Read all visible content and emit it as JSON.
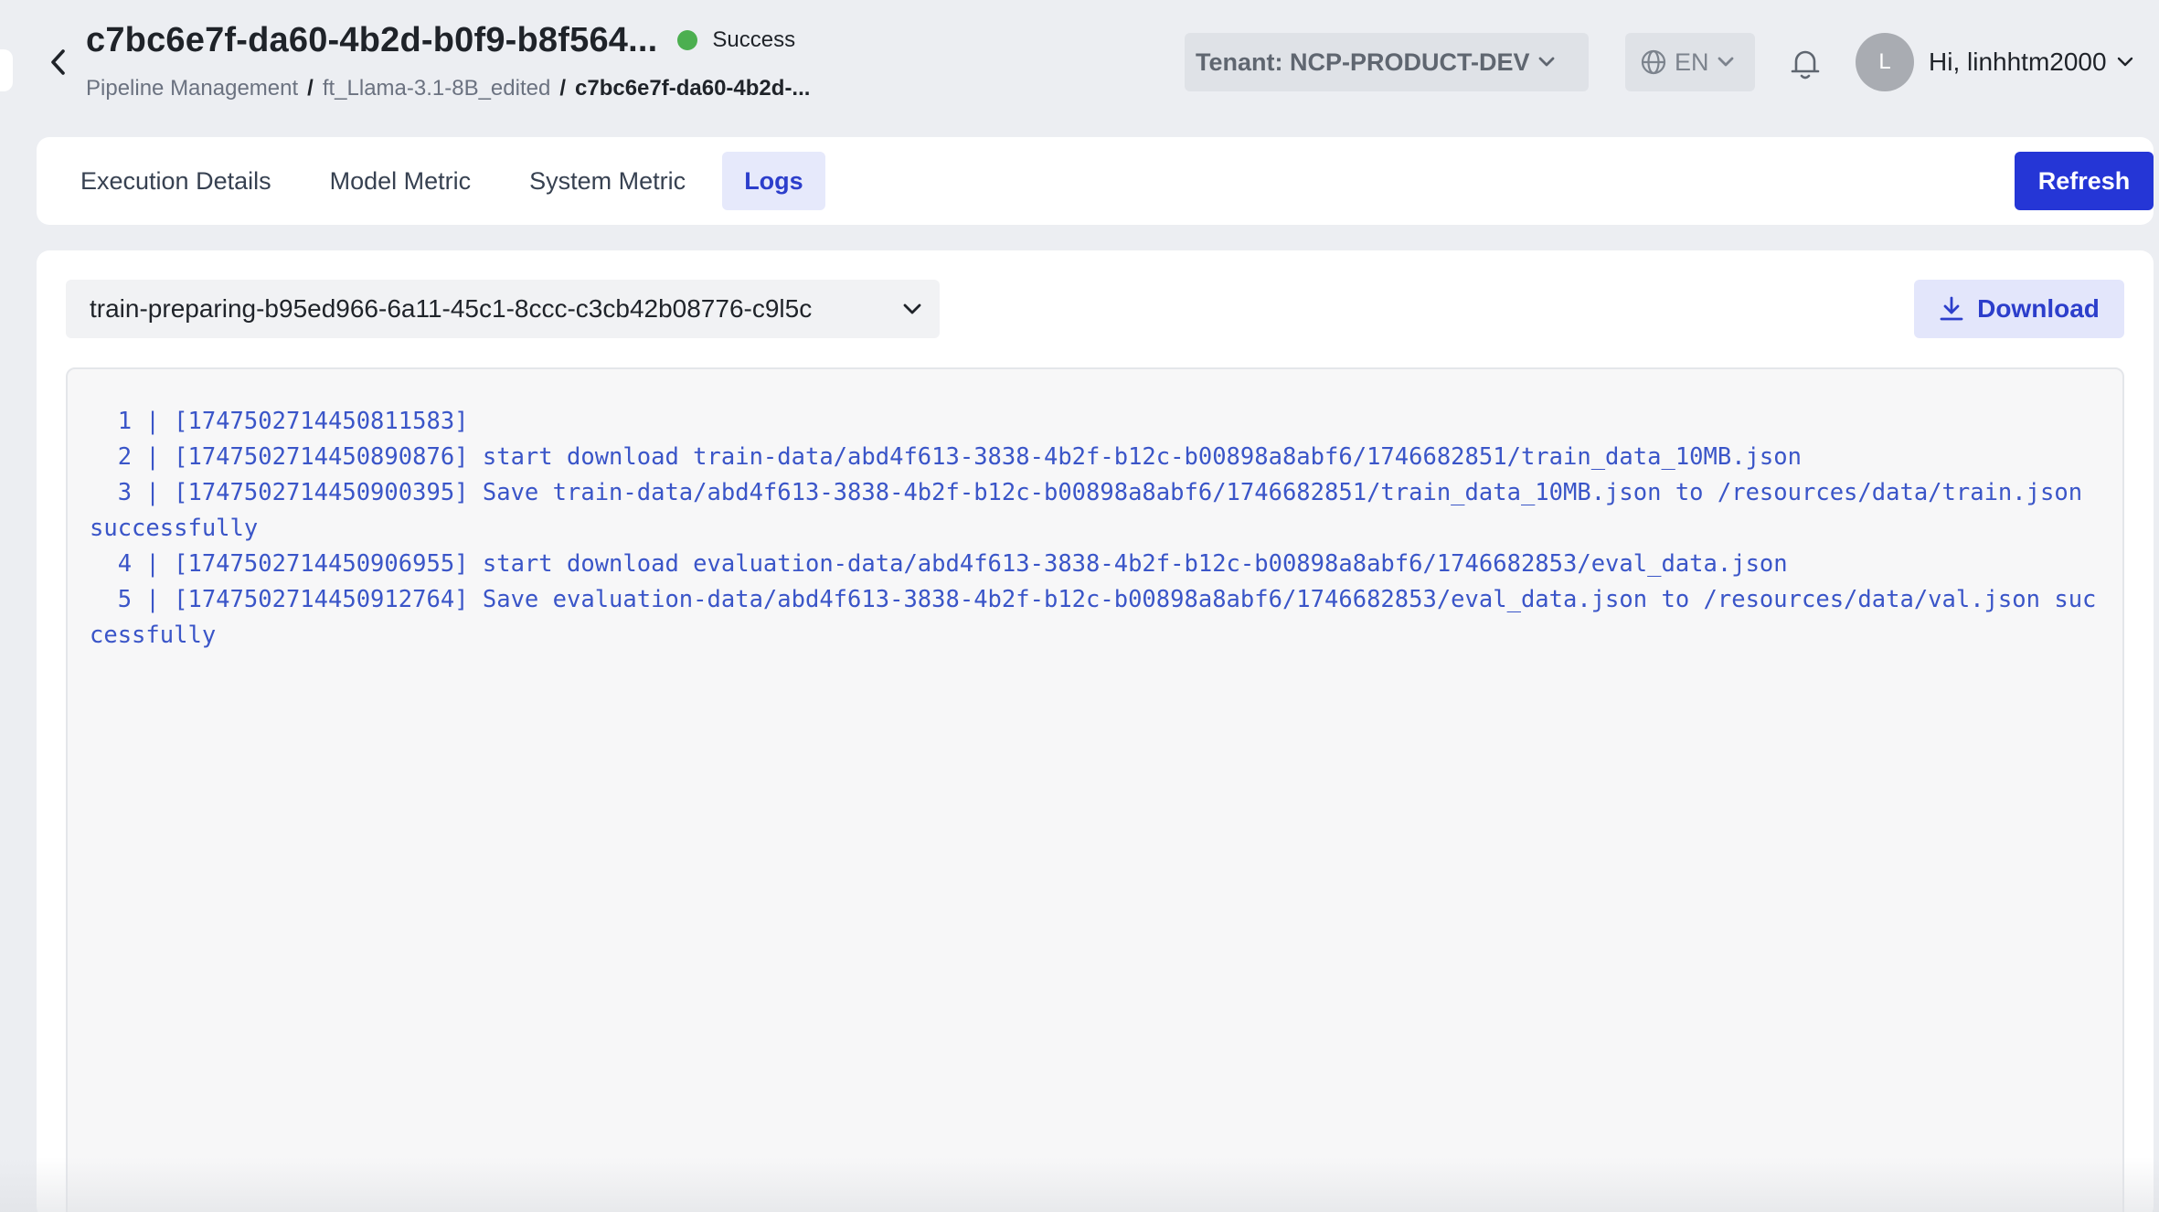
{
  "header": {
    "title": "c7bc6e7f-da60-4b2d-b0f9-b8f564...",
    "status": "Success",
    "status_color": "#4caf50",
    "breadcrumb": [
      "Pipeline Management",
      "ft_Llama-3.1-8B_edited",
      "c7bc6e7f-da60-4b2d-..."
    ],
    "breadcrumb_sep": "/",
    "tenant_label": "Tenant: NCP-PRODUCT-DEV",
    "language": "EN",
    "avatar_initial": "L",
    "greeting": "Hi, linhhtm2000"
  },
  "tabs": [
    {
      "label": "Execution Details",
      "active": false
    },
    {
      "label": "Model Metric",
      "active": false
    },
    {
      "label": "System Metric",
      "active": false
    },
    {
      "label": "Logs",
      "active": true
    }
  ],
  "toolbar": {
    "refresh_label": "Refresh",
    "download_label": "Download",
    "pod_selected": "train-preparing-b95ed966-6a11-45c1-8ccc-c3cb42b08776-c9l5c"
  },
  "logs": [
    "  1 | [1747502714450811583]",
    "  2 | [1747502714450890876] start download train-data/abd4f613-3838-4b2f-b12c-b00898a8abf6/1746682851/train_data_10MB.json",
    "  3 | [1747502714450900395] Save train-data/abd4f613-3838-4b2f-b12c-b00898a8abf6/1746682851/train_data_10MB.json to /resources/data/train.json successfully",
    "  4 | [1747502714450906955] start download evaluation-data/abd4f613-3838-4b2f-b12c-b00898a8abf6/1746682853/eval_data.json",
    "  5 | [1747502714450912764] Save evaluation-data/abd4f613-3838-4b2f-b12c-b00898a8abf6/1746682853/eval_data.json to /resources/data/val.json successfully"
  ],
  "colors": {
    "primary": "#2536d6",
    "log_text": "#3a55c8",
    "active_tab_bg": "#e6e9fb"
  },
  "icons": {
    "back": "chevron-left-icon",
    "tenant": "chevron-down-icon",
    "lang": "globe-icon",
    "bell": "bell-icon",
    "download": "download-icon"
  }
}
